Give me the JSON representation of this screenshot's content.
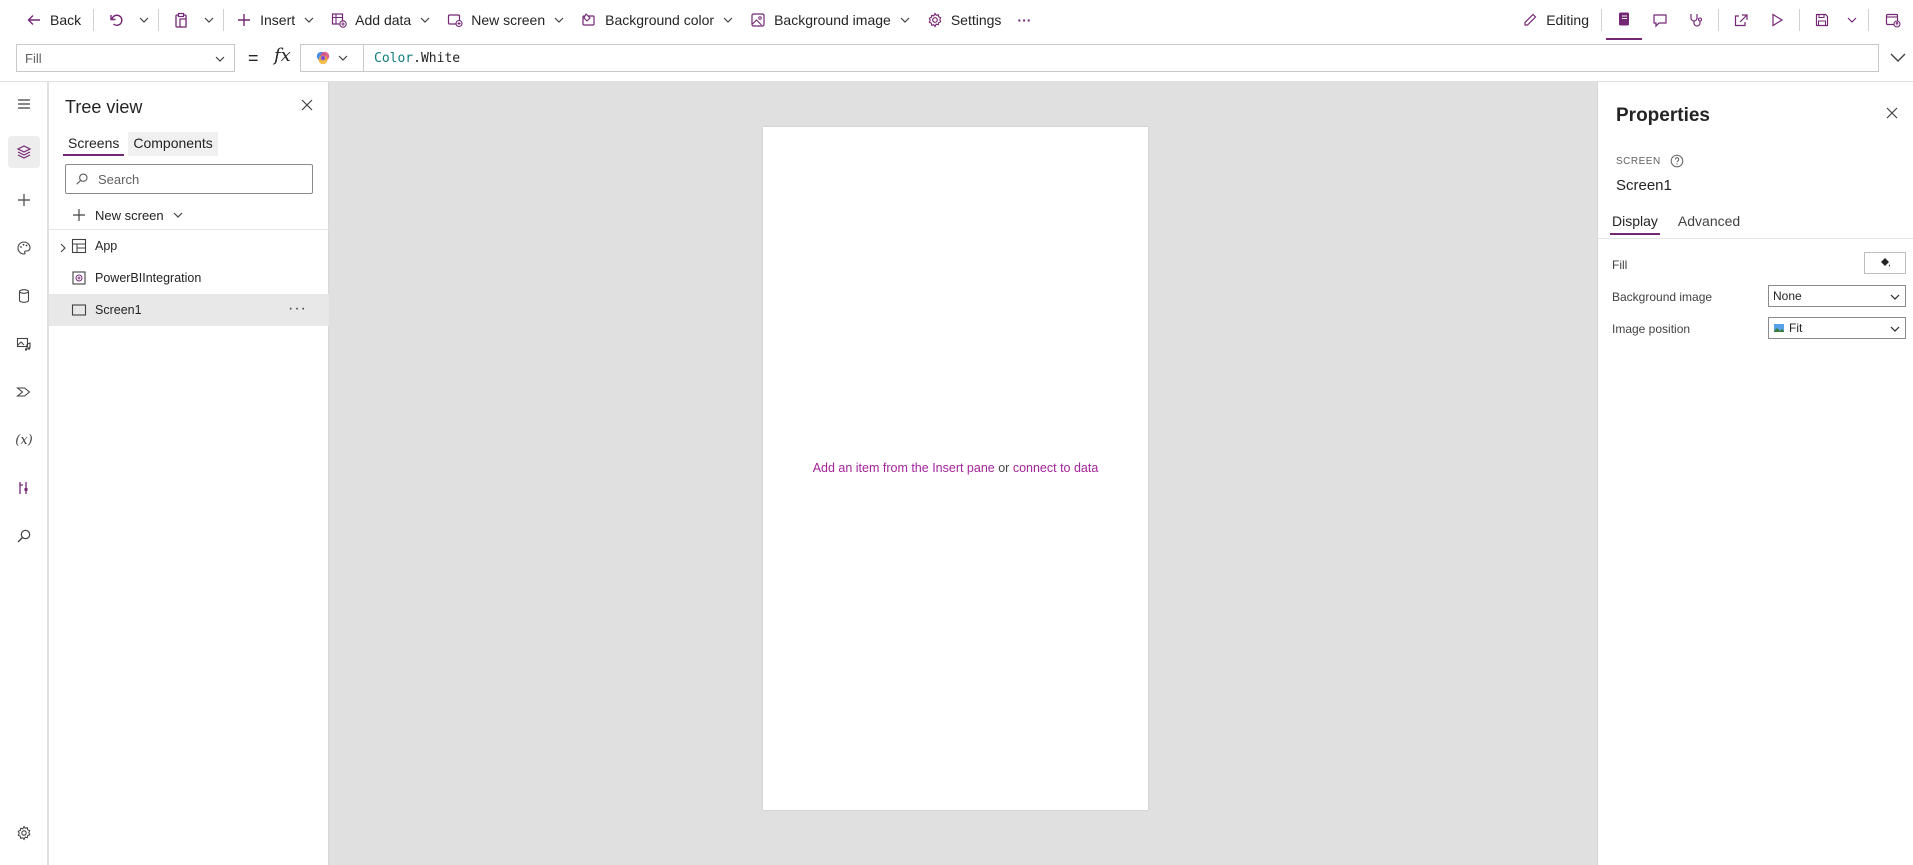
{
  "toolbar": {
    "back_label": "Back",
    "insert_label": "Insert",
    "add_data_label": "Add data",
    "new_screen_label": "New screen",
    "background_color_label": "Background color",
    "background_image_label": "Background image",
    "settings_label": "Settings",
    "more_label": "···",
    "editing_label": "Editing"
  },
  "formula_bar": {
    "property": "Fill",
    "equals": "=",
    "fx": "fx",
    "formula_keyword": "Color",
    "formula_rest": ".White"
  },
  "tree_view": {
    "title": "Tree view",
    "tabs": [
      {
        "label": "Screens",
        "active": true
      },
      {
        "label": "Components",
        "active": false
      }
    ],
    "search_placeholder": "Search",
    "new_screen_label": "New screen",
    "items": [
      {
        "label": "App",
        "icon": "app-icon",
        "expandable": true,
        "selected": false
      },
      {
        "label": "PowerBIIntegration",
        "icon": "powerbi-integration-icon",
        "expandable": false,
        "selected": false
      },
      {
        "label": "Screen1",
        "icon": "screen-icon",
        "expandable": false,
        "selected": true
      }
    ]
  },
  "canvas": {
    "empty_part1": "Add an item from the Insert pane",
    "empty_part2": "or",
    "empty_part3": "connect to data"
  },
  "properties": {
    "title": "Properties",
    "type_label": "SCREEN",
    "name": "Screen1",
    "tabs": [
      {
        "label": "Display",
        "active": true
      },
      {
        "label": "Advanced",
        "active": false
      }
    ],
    "fill_label": "Fill",
    "background_image_label": "Background image",
    "background_image_value": "None",
    "image_position_label": "Image position",
    "image_position_value": "Fit"
  },
  "colors": {
    "accent": "#742774",
    "link": "#a3239b",
    "canvas_bg": "#e0e0e0"
  }
}
